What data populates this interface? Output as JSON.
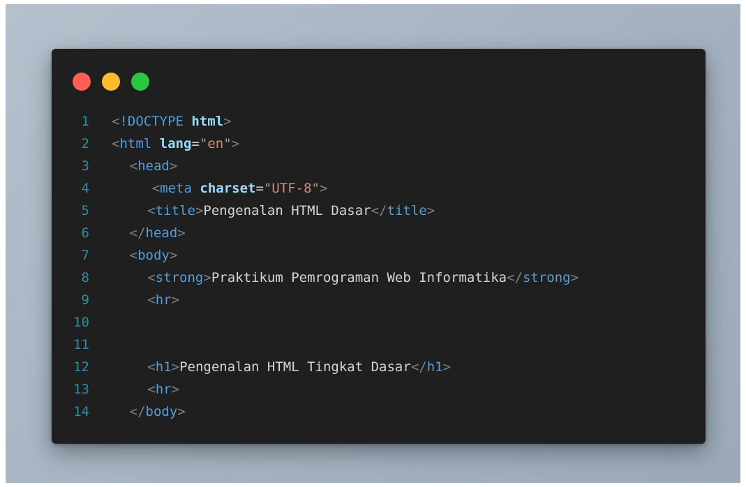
{
  "colors": {
    "background": "#a7b4c2",
    "editor_bg": "#1f1f1f",
    "line_number": "#2f8da1",
    "dot_red": "#ff5f57",
    "dot_yellow": "#febc2e",
    "dot_green": "#28c840",
    "bracket": "#808080",
    "tag": "#569cd6",
    "attr": "#9cdcfe",
    "string": "#ce9178",
    "text": "#d4d4d4"
  },
  "window_controls": {
    "close_icon": "red-dot",
    "minimize_icon": "yellow-dot",
    "maximize_icon": "green-dot"
  },
  "code_lines": [
    {
      "number": "1",
      "indent": 0,
      "tokens": [
        {
          "t": "<",
          "c": "bracket"
        },
        {
          "t": "!DOCTYPE",
          "c": "tag"
        },
        {
          "t": " ",
          "c": "text"
        },
        {
          "t": "html",
          "c": "attr",
          "bold": true
        },
        {
          "t": ">",
          "c": "bracket"
        }
      ]
    },
    {
      "number": "2",
      "indent": 0,
      "tokens": [
        {
          "t": "<",
          "c": "bracket"
        },
        {
          "t": "html",
          "c": "tag"
        },
        {
          "t": " ",
          "c": "text"
        },
        {
          "t": "lang",
          "c": "attr",
          "bold": true
        },
        {
          "t": "=",
          "c": "text"
        },
        {
          "t": "\"en\"",
          "c": "string"
        },
        {
          "t": ">",
          "c": "bracket"
        }
      ]
    },
    {
      "number": "3",
      "indent": 4,
      "tokens": [
        {
          "t": "<",
          "c": "bracket"
        },
        {
          "t": "head",
          "c": "tag"
        },
        {
          "t": ">",
          "c": "bracket"
        }
      ]
    },
    {
      "number": "4",
      "indent": 9,
      "tokens": [
        {
          "t": "<",
          "c": "bracket"
        },
        {
          "t": "meta",
          "c": "tag"
        },
        {
          "t": " ",
          "c": "text"
        },
        {
          "t": "charset",
          "c": "attr",
          "bold": true
        },
        {
          "t": "=",
          "c": "text"
        },
        {
          "t": "\"UTF-8\"",
          "c": "string"
        },
        {
          "t": ">",
          "c": "bracket"
        }
      ]
    },
    {
      "number": "5",
      "indent": 8,
      "tokens": [
        {
          "t": "<",
          "c": "bracket"
        },
        {
          "t": "title",
          "c": "tag"
        },
        {
          "t": ">",
          "c": "bracket"
        },
        {
          "t": "Pengenalan HTML Dasar",
          "c": "text"
        },
        {
          "t": "</",
          "c": "bracket"
        },
        {
          "t": "title",
          "c": "tag"
        },
        {
          "t": ">",
          "c": "bracket"
        }
      ]
    },
    {
      "number": "6",
      "indent": 4,
      "tokens": [
        {
          "t": "</",
          "c": "bracket"
        },
        {
          "t": "head",
          "c": "tag"
        },
        {
          "t": ">",
          "c": "bracket"
        }
      ]
    },
    {
      "number": "7",
      "indent": 4,
      "tokens": [
        {
          "t": "<",
          "c": "bracket"
        },
        {
          "t": "body",
          "c": "tag"
        },
        {
          "t": ">",
          "c": "bracket"
        }
      ]
    },
    {
      "number": "8",
      "indent": 8,
      "tokens": [
        {
          "t": "<",
          "c": "bracket"
        },
        {
          "t": "strong",
          "c": "tag"
        },
        {
          "t": ">",
          "c": "bracket"
        },
        {
          "t": "Praktikum Pemrograman Web Informatika",
          "c": "text"
        },
        {
          "t": "</",
          "c": "bracket"
        },
        {
          "t": "strong",
          "c": "tag"
        },
        {
          "t": ">",
          "c": "bracket"
        }
      ]
    },
    {
      "number": "9",
      "indent": 8,
      "tokens": [
        {
          "t": "<",
          "c": "bracket"
        },
        {
          "t": "hr",
          "c": "tag"
        },
        {
          "t": ">",
          "c": "bracket"
        }
      ]
    },
    {
      "number": "10",
      "indent": 0,
      "tokens": []
    },
    {
      "number": "11",
      "indent": 0,
      "tokens": []
    },
    {
      "number": "12",
      "indent": 8,
      "tokens": [
        {
          "t": "<",
          "c": "bracket"
        },
        {
          "t": "h1",
          "c": "tag"
        },
        {
          "t": ">",
          "c": "bracket"
        },
        {
          "t": "Pengenalan HTML Tingkat Dasar",
          "c": "text"
        },
        {
          "t": "</",
          "c": "bracket"
        },
        {
          "t": "h1",
          "c": "tag"
        },
        {
          "t": ">",
          "c": "bracket"
        }
      ]
    },
    {
      "number": "13",
      "indent": 8,
      "tokens": [
        {
          "t": "<",
          "c": "bracket"
        },
        {
          "t": "hr",
          "c": "tag"
        },
        {
          "t": ">",
          "c": "bracket"
        }
      ]
    },
    {
      "number": "14",
      "indent": 4,
      "tokens": [
        {
          "t": "</",
          "c": "bracket"
        },
        {
          "t": "body",
          "c": "tag"
        },
        {
          "t": ">",
          "c": "bracket"
        }
      ]
    }
  ]
}
